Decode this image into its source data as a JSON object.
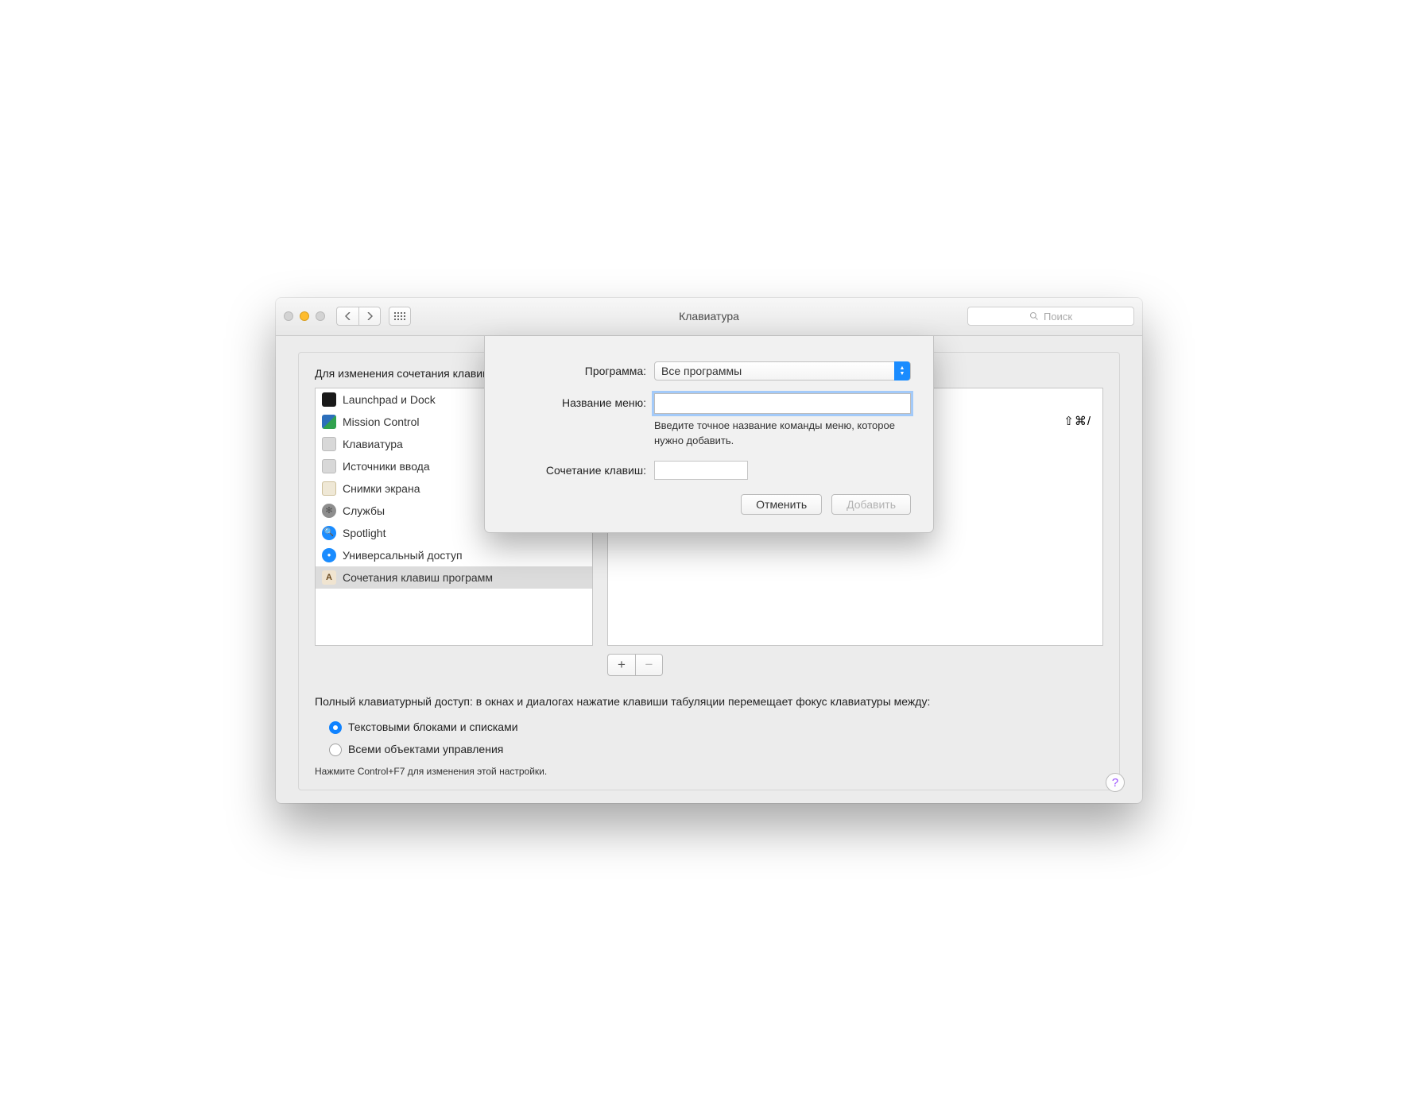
{
  "window": {
    "title": "Клавиатура",
    "search_placeholder": "Поиск"
  },
  "instruct": "Для изменения сочетания клавиш выберите его, нажмите сочетание клавиш, затем введите новые клавиши.",
  "categories": [
    {
      "label": "Launchpad и Dock",
      "icon": "launchpad"
    },
    {
      "label": "Mission Control",
      "icon": "mission"
    },
    {
      "label": "Клавиатура",
      "icon": "keyboard"
    },
    {
      "label": "Источники ввода",
      "icon": "input"
    },
    {
      "label": "Снимки экрана",
      "icon": "screenshot"
    },
    {
      "label": "Службы",
      "icon": "services"
    },
    {
      "label": "Spotlight",
      "icon": "spotlight"
    },
    {
      "label": "Универсальный доступ",
      "icon": "access"
    },
    {
      "label": "Сочетания клавиш программ",
      "icon": "apps",
      "selected": true
    }
  ],
  "shortcut_hint": "⇧⌘/",
  "plus": "+",
  "minus": "−",
  "full_access": {
    "line1": "Полный клавиатурный доступ: в окнах и диалогах нажатие клавиши табуляции перемещает фокус клавиатуры между:",
    "opt1": "Текстовыми блоками и списками",
    "opt2": "Всеми объектами управления",
    "hint": "Нажмите Control+F7 для изменения этой настройки."
  },
  "sheet": {
    "program_label": "Программа:",
    "program_value": "Все программы",
    "menu_label": "Название меню:",
    "menu_helper": "Введите точное название команды меню, которое нужно добавить.",
    "shortcut_label": "Сочетание клавиш:",
    "cancel": "Отменить",
    "add": "Добавить"
  },
  "help": "?"
}
